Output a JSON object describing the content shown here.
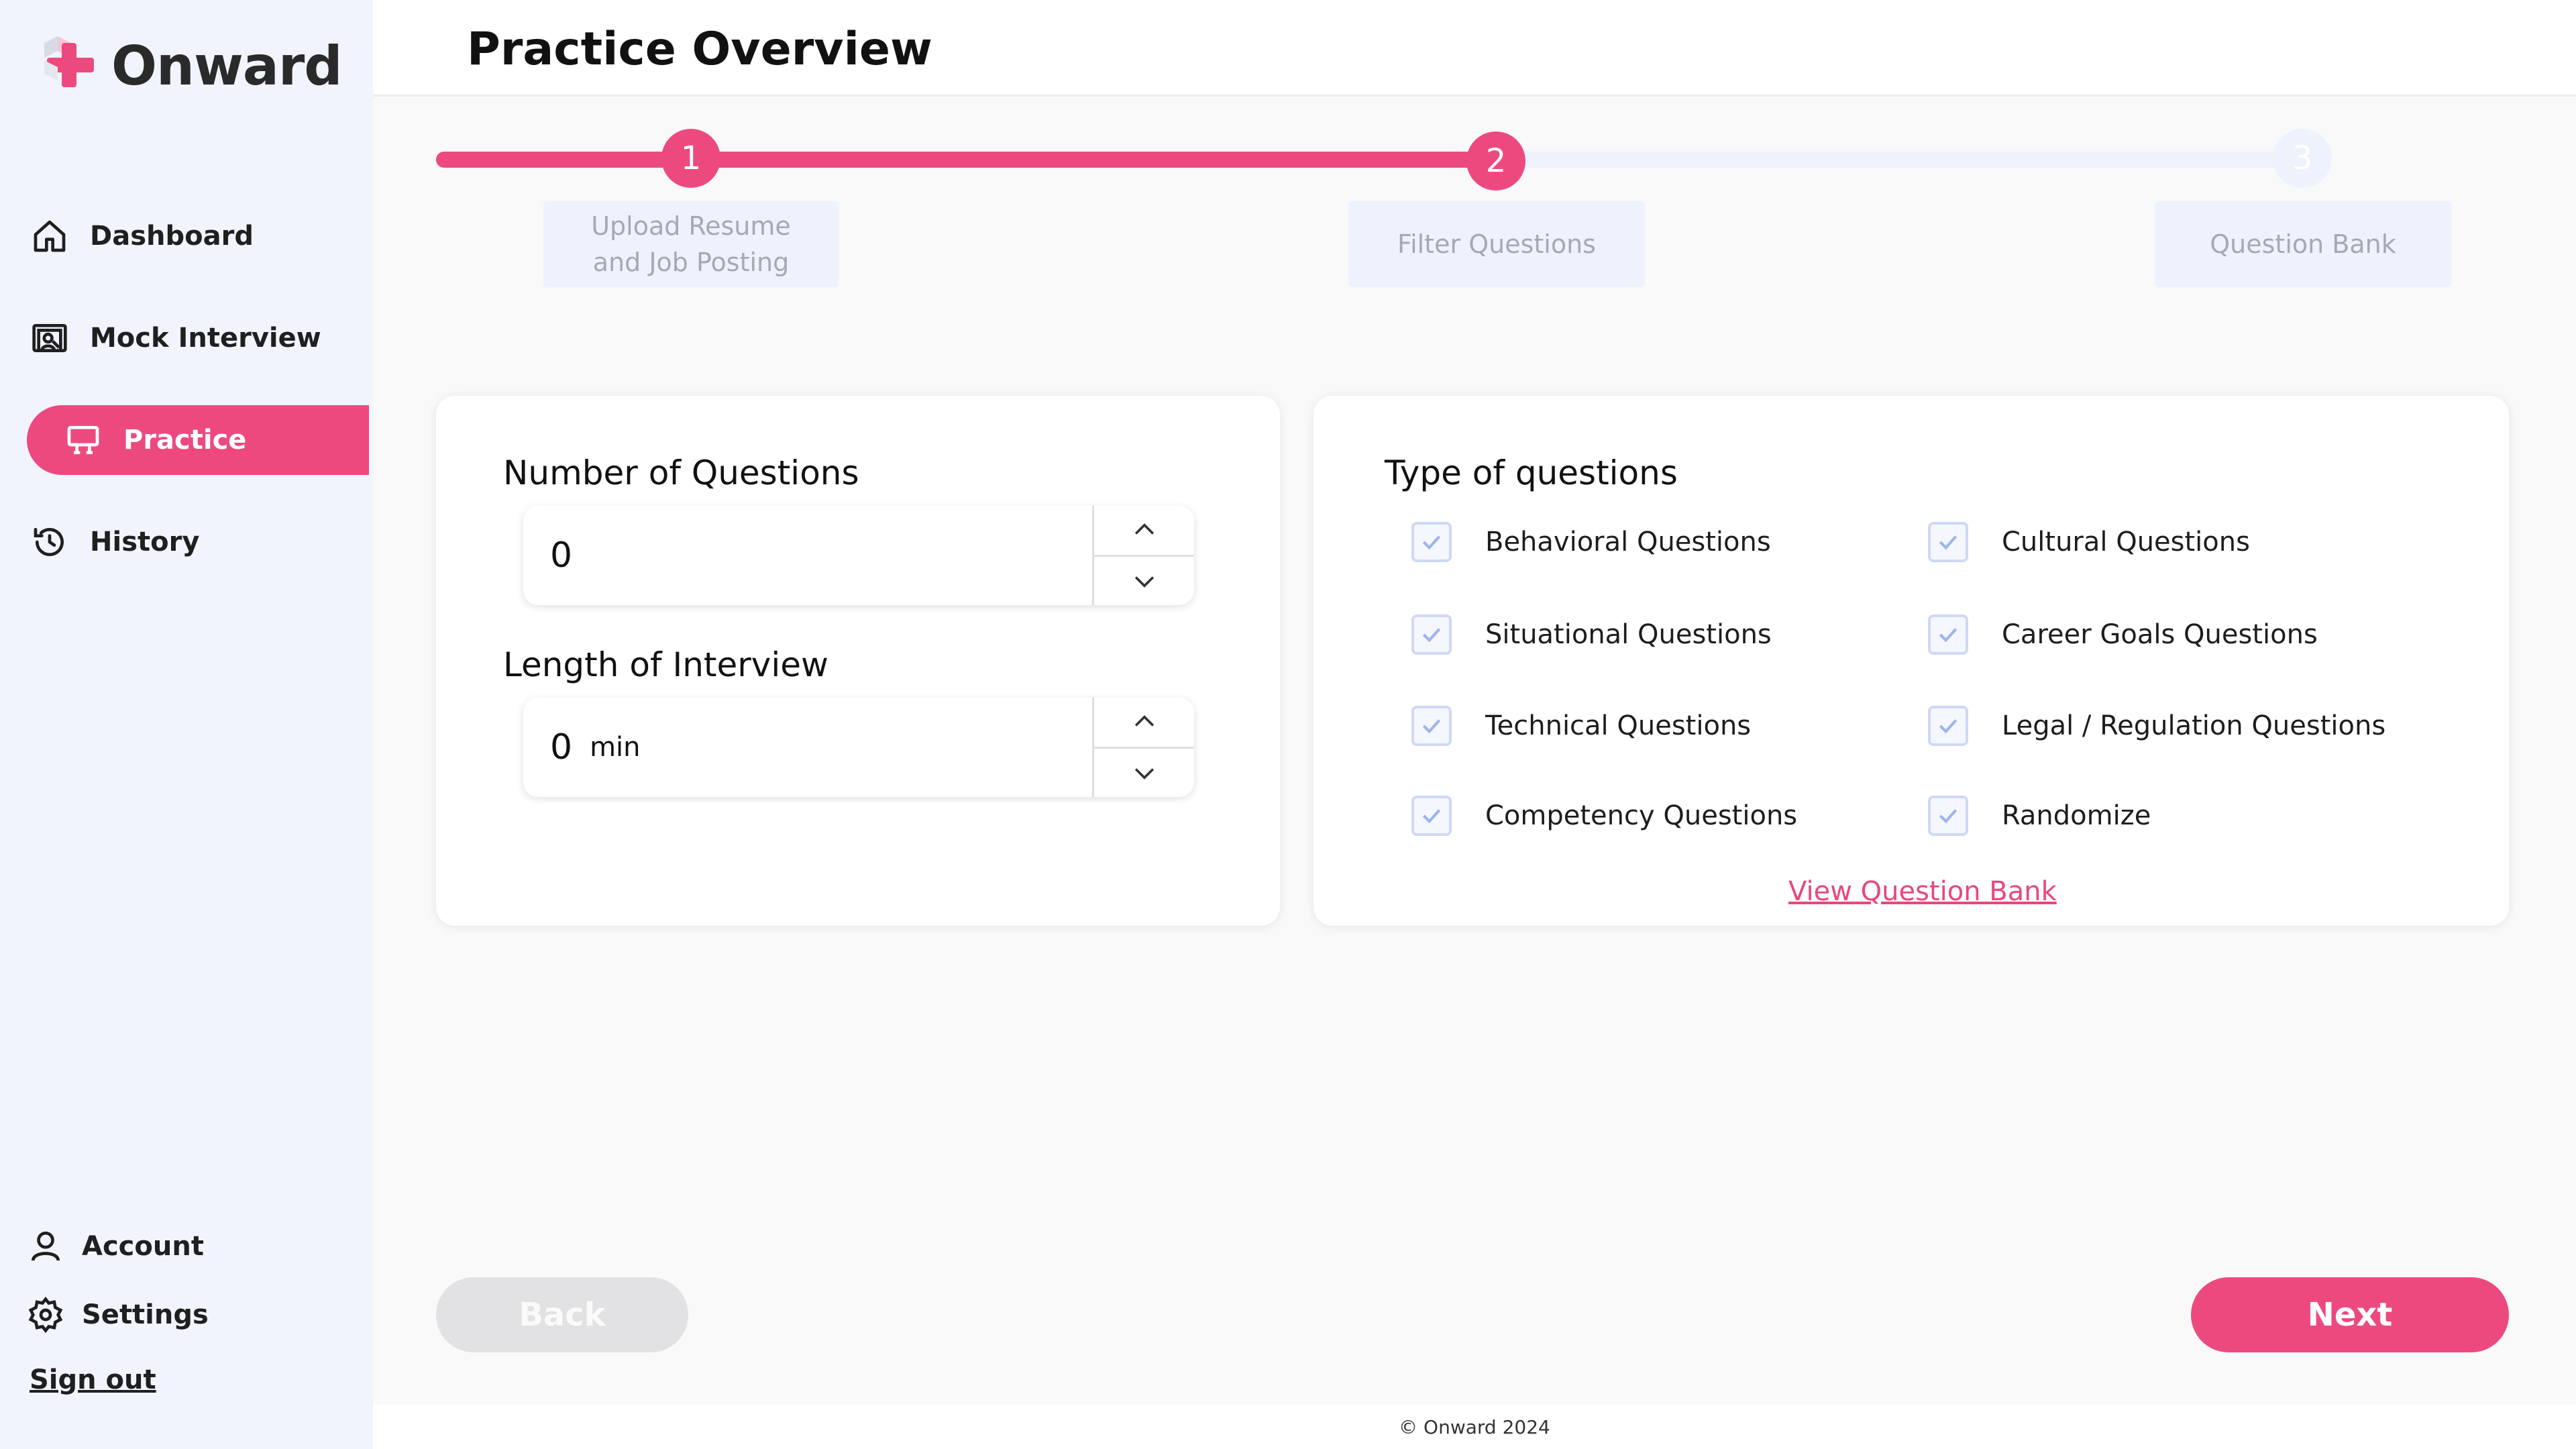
{
  "app": {
    "name": "Onward"
  },
  "sidebar": {
    "items": [
      {
        "label": "Dashboard",
        "icon": "home-icon"
      },
      {
        "label": "Mock Interview",
        "icon": "video-call-icon"
      },
      {
        "label": "Practice",
        "icon": "presentation-board-icon",
        "active": true
      },
      {
        "label": "History",
        "icon": "history-icon"
      }
    ],
    "bottom": [
      {
        "label": "Account",
        "icon": "user-icon"
      },
      {
        "label": "Settings",
        "icon": "gear-icon"
      }
    ],
    "signout": "Sign out"
  },
  "header": {
    "title": "Practice Overview"
  },
  "stepper": {
    "current_step": 2,
    "steps": [
      {
        "number": "1",
        "label": "Upload Resume and Job Posting",
        "label_line1": "Upload Resume",
        "label_line2": "and Job Posting"
      },
      {
        "number": "2",
        "label": "Filter Questions"
      },
      {
        "number": "3",
        "label": "Question Bank"
      }
    ]
  },
  "settings_card": {
    "num_questions_label": "Number of Questions",
    "num_questions_value": "0",
    "length_label": "Length of Interview",
    "length_value": "0",
    "length_unit": "min"
  },
  "types_card": {
    "title": "Type of questions",
    "options": [
      {
        "label": "Behavioral Questions",
        "checked": true
      },
      {
        "label": "Cultural Questions",
        "checked": true
      },
      {
        "label": "Situational Questions",
        "checked": true
      },
      {
        "label": "Career Goals Questions",
        "checked": true
      },
      {
        "label": "Technical Questions",
        "checked": true
      },
      {
        "label": "Legal / Regulation Questions",
        "checked": true
      },
      {
        "label": "Competency Questions",
        "checked": true
      },
      {
        "label": "Randomize",
        "checked": true
      }
    ],
    "view_bank_link": "View Question Bank"
  },
  "actions": {
    "back": "Back",
    "next": "Next"
  },
  "footer": {
    "text": "© Onward 2024"
  },
  "colors": {
    "accent": "#ec4a7f",
    "sidebar_bg": "#f1f4fd",
    "inactive_track": "#eef2fc",
    "checkbox_border": "#cfd8f6",
    "check_mark": "#9fb4ec"
  }
}
